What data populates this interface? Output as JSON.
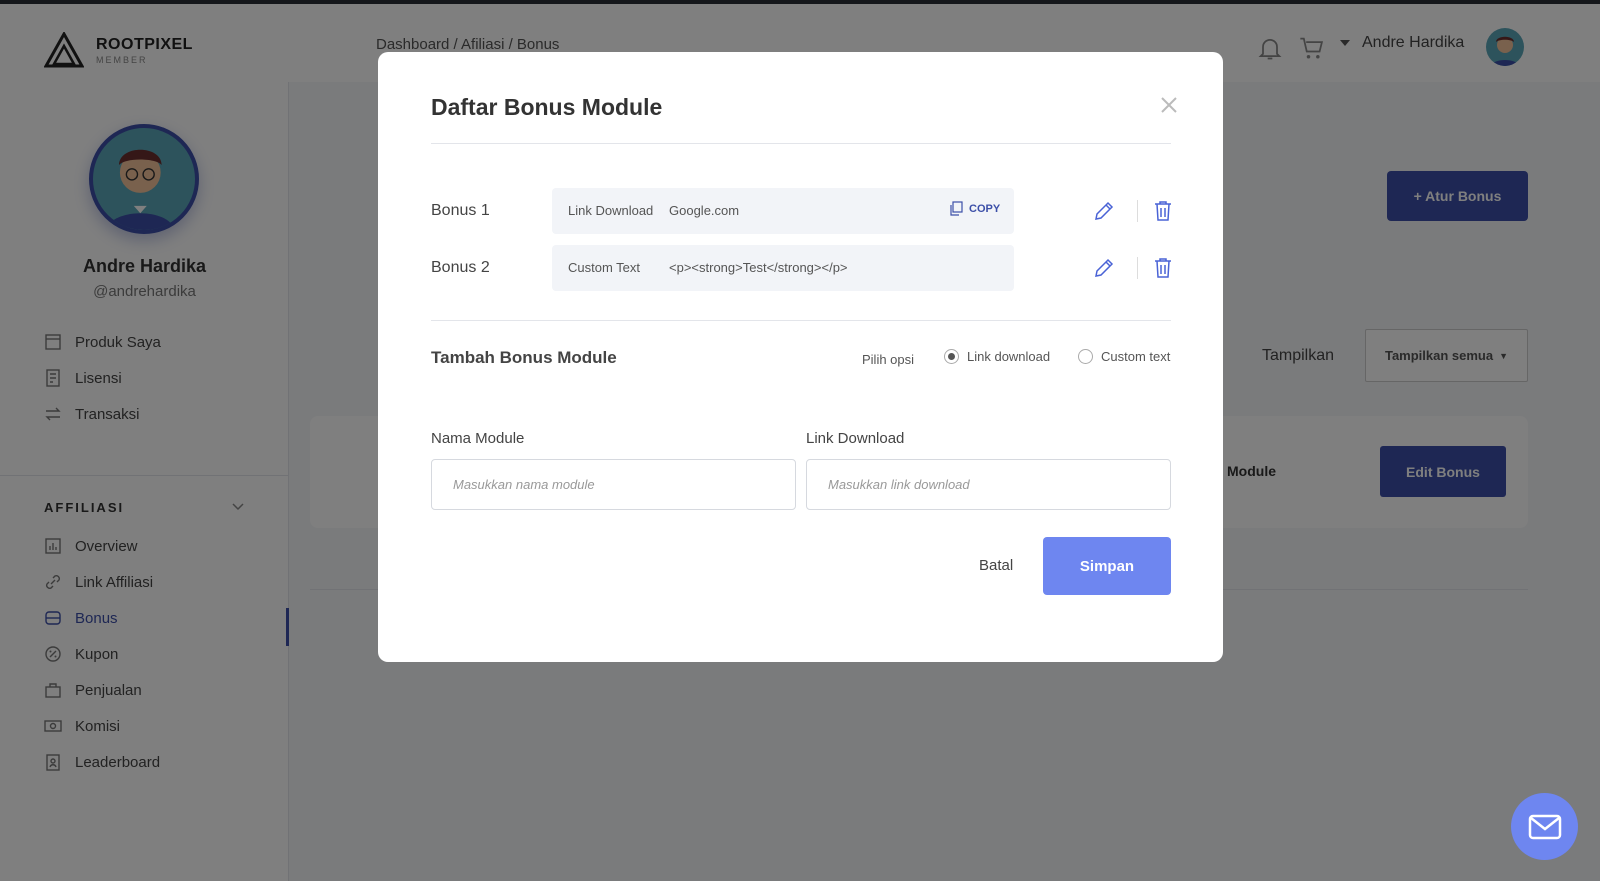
{
  "brand": {
    "name": "ROOTPIXEL",
    "sub": "MEMBER"
  },
  "header": {
    "breadcrumb": "Dashboard / Afiliasi / Bonus",
    "user_name": "Andre Hardika"
  },
  "sidebar": {
    "profile": {
      "name": "Andre Hardika",
      "handle": "@andrehardika"
    },
    "main_items": [
      {
        "label": "Produk Saya",
        "icon": "product-icon"
      },
      {
        "label": "Lisensi",
        "icon": "license-icon"
      },
      {
        "label": "Transaksi",
        "icon": "transaction-icon"
      }
    ],
    "section_label": "AFFILIASI",
    "affiliate_items": [
      {
        "label": "Overview",
        "icon": "chart-icon"
      },
      {
        "label": "Link Affiliasi",
        "icon": "link-icon"
      },
      {
        "label": "Bonus",
        "icon": "bonus-icon",
        "active": true
      },
      {
        "label": "Kupon",
        "icon": "coupon-icon"
      },
      {
        "label": "Penjualan",
        "icon": "sales-icon"
      },
      {
        "label": "Komisi",
        "icon": "commission-icon"
      },
      {
        "label": "Leaderboard",
        "icon": "leaderboard-icon"
      }
    ]
  },
  "page": {
    "atur_bonus_label": "+ Atur Bonus",
    "tampilkan_label": "Tampilkan",
    "tampilkan_select": "Tampilkan semua",
    "card_module_text": "Module",
    "edit_bonus_label": "Edit Bonus"
  },
  "modal": {
    "title": "Daftar Bonus Module",
    "bonuses": [
      {
        "name": "Bonus 1",
        "type_label": "Link Download",
        "value": "Google.com",
        "copy_label": "COPY"
      },
      {
        "name": "Bonus 2",
        "type_label": "Custom Text",
        "value": "<p><strong>Test</strong></p>"
      }
    ],
    "add_title": "Tambah Bonus Module",
    "option_label": "Pilih opsi",
    "option_link": "Link download",
    "option_custom": "Custom text",
    "name_label": "Nama Module",
    "name_placeholder": "Masukkan nama module",
    "link_label": "Link Download",
    "link_placeholder": "Masukkan link download",
    "cancel_label": "Batal",
    "save_label": "Simpan"
  },
  "colors": {
    "primary": "#3c4fa8",
    "accent": "#6e86f0",
    "overlay": "rgba(0,0,0,0.5)"
  }
}
